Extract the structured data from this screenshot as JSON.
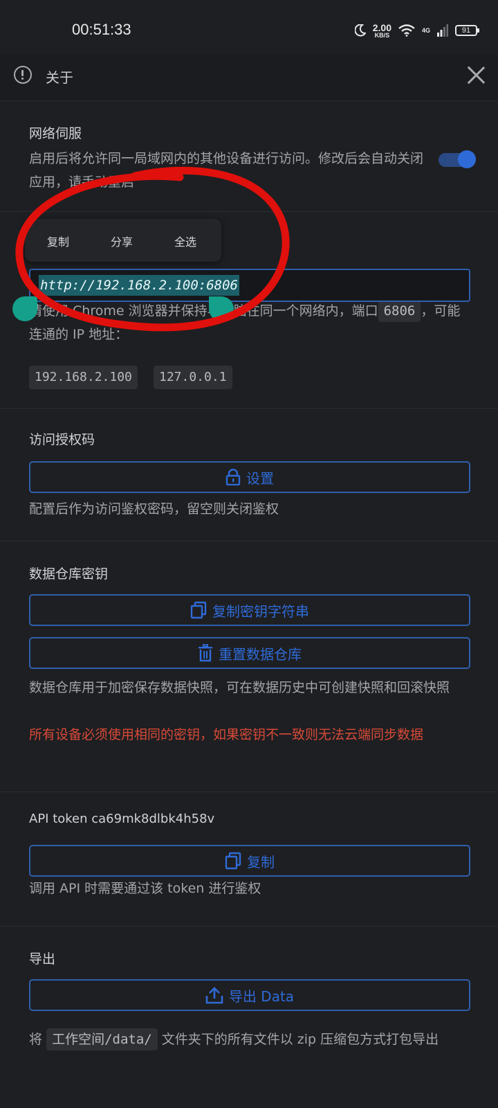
{
  "status_bar": {
    "time": "00:51:33",
    "speed_value": "2.00",
    "speed_unit": "KB/S",
    "network": "4G",
    "battery": "91"
  },
  "header": {
    "title": "关于"
  },
  "network_service": {
    "title": "网络伺服",
    "description": "启用后将允许同一局域网内的其他设备进行访问。修改后会自动关闭应用，请手动重启",
    "enabled": true
  },
  "context_menu": {
    "items": [
      "复制",
      "分享",
      "全选"
    ]
  },
  "url_field": {
    "value": "http://192.168.2.100:6806"
  },
  "access_note": {
    "prefix": "请使用 Chrome 浏览器并保持与电脑在同一个网络内，端口",
    "port": "6806",
    "suffix": "，可能连通的 IP 地址：",
    "ips": [
      "192.168.2.100",
      "127.0.0.1"
    ]
  },
  "auth_code": {
    "title": "访问授权码",
    "button": "设置",
    "description": "配置后作为访问鉴权密码，留空则关闭鉴权"
  },
  "repo_key": {
    "title": "数据仓库密钥",
    "copy_button": "复制密钥字符串",
    "reset_button": "重置数据仓库",
    "description": "数据仓库用于加密保存数据快照，可在数据历史中可创建快照和回滚快照",
    "warning": "所有设备必须使用相同的密钥，如果密钥不一致则无法云端同步数据"
  },
  "api_token": {
    "title": "API token ca69mk8dlbk4h58v",
    "button": "复制",
    "description": "调用 API 时需要通过该 token 进行鉴权"
  },
  "export": {
    "title": "导出",
    "button": "导出 Data",
    "prefix": "将",
    "path": "工作空间/data/",
    "suffix": "文件夹下的所有文件以 zip 压缩包方式打包导出"
  },
  "colors": {
    "accent": "#2f6bd8",
    "warning": "#d84a38",
    "selection": "#1c5f68",
    "annotation": "#e0100c"
  }
}
